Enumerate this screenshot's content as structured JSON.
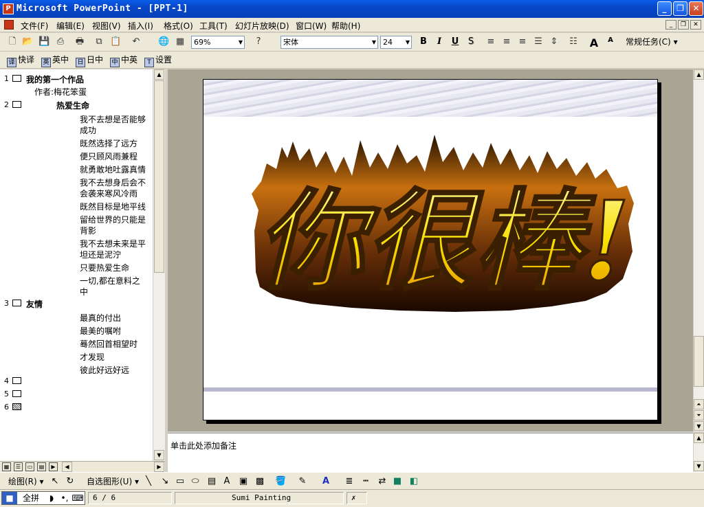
{
  "window": {
    "title": "Microsoft PowerPoint - [PPT-1]",
    "minimize": "_",
    "restore": "❐",
    "close": "✕"
  },
  "menu": {
    "items": [
      "文件(F)",
      "编辑(E)",
      "视图(V)",
      "插入(I)",
      "格式(O)",
      "工具(T)",
      "幻灯片放映(D)",
      "窗口(W)",
      "帮助(H)"
    ]
  },
  "toolbar": {
    "zoom": "69%",
    "font": "宋体",
    "font_size": "24",
    "bold": "B",
    "italic": "I",
    "underline": "U",
    "shadow": "S",
    "tasks": "常规任务(C)",
    "font_up": "A",
    "font_down": "A"
  },
  "toolbar2": {
    "items": [
      "快译",
      "英中",
      "日中",
      "中英",
      "设置"
    ]
  },
  "outline": {
    "slide1_num": "1",
    "slide1_title": "我的第一个作品",
    "slide1_sub": "作者:梅花笨蛋",
    "slide2_num": "2",
    "slide2_title": "热爱生命",
    "slide2_lines": [
      "我不去想是否能够",
      "成功",
      "既然选择了远方",
      "便只顾风雨兼程",
      "就勇敢地吐露真情",
      "我不去想身后会不",
      "会袭来寒风冷雨",
      "既然目标是地平线",
      "留给世界的只能是",
      "背影",
      "我不去想未来是平",
      "坦还是泥泞",
      "只要热爱生命",
      "一切,都在意料之",
      "中"
    ],
    "slide3_num": "3",
    "slide3_title": "友情",
    "slide3_lines": [
      "最真的付出",
      "最美的嘱咐",
      "蓦然回首相望时",
      "才发现",
      "彼此好远好远"
    ],
    "slide4_num": "4",
    "slide5_num": "5",
    "slide6_num": "6"
  },
  "slide": {
    "wordart": "你很棒!"
  },
  "notes": {
    "placeholder": "单击此处添加备注"
  },
  "drawbar": {
    "draw": "绘图(R)",
    "autoshapes": "自选图形(U)"
  },
  "status": {
    "ime_mode": "全拼",
    "page": "6 / 6",
    "template": "Sumi Painting"
  },
  "colors": {
    "title_bar": "#0846c8",
    "fire_yellow": "#f8e000",
    "fire_dark": "#201000"
  }
}
